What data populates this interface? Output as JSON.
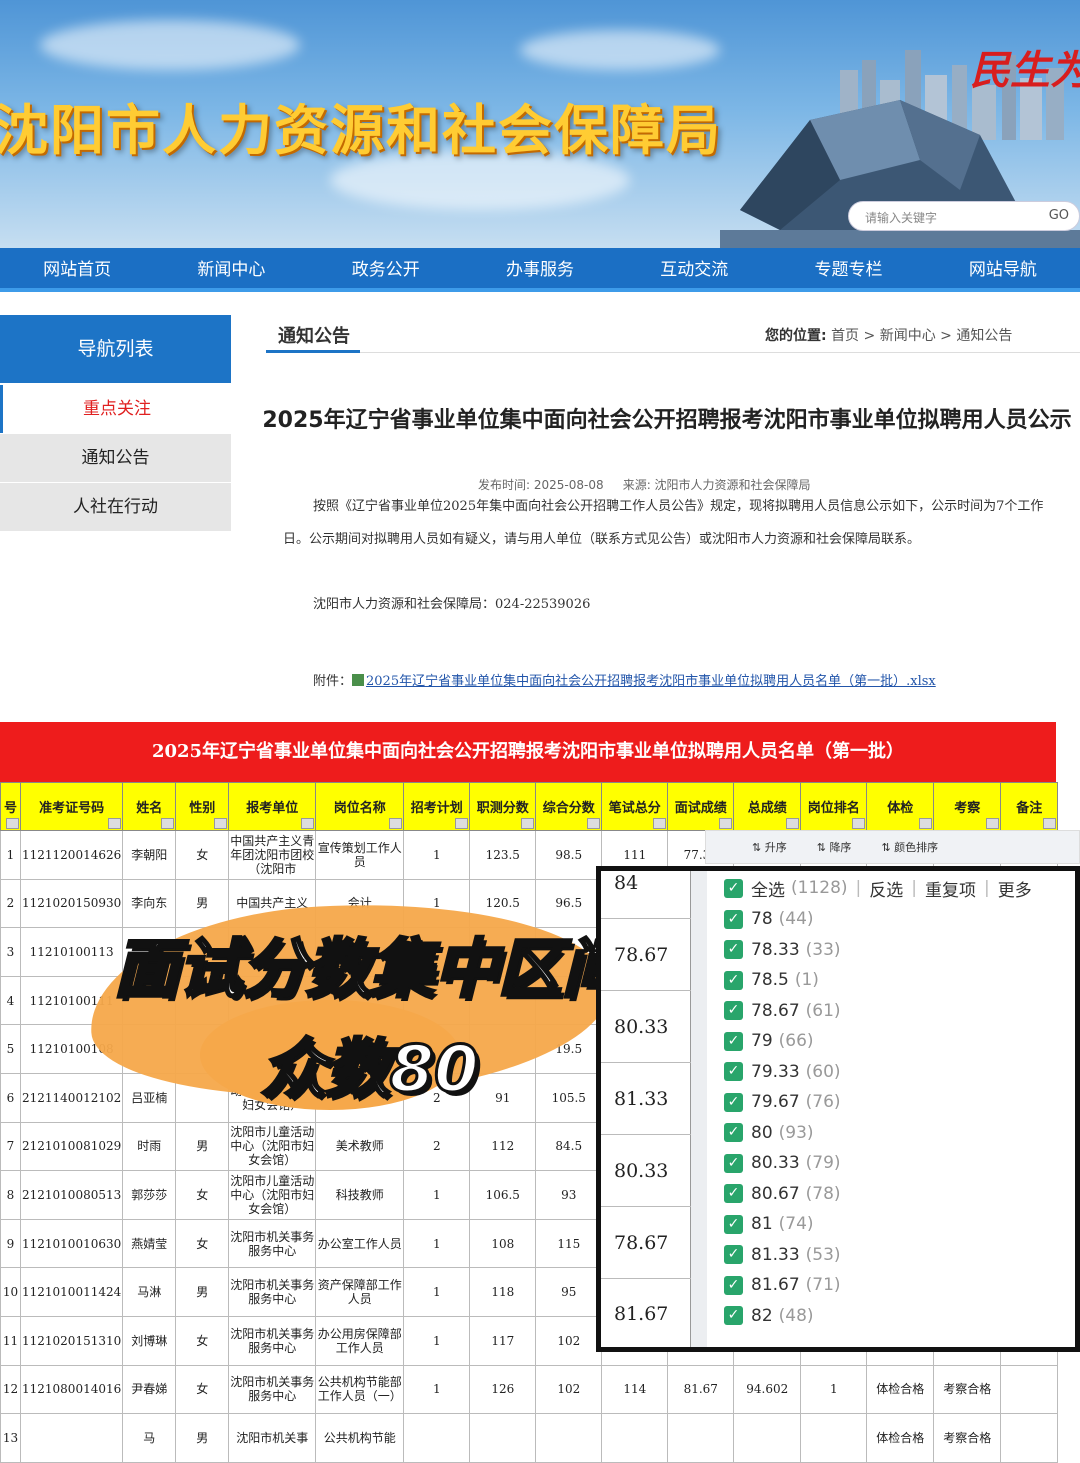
{
  "banner": {
    "site_title": "沈阳市人力资源和社会保障局",
    "slogan": "民生为",
    "search_placeholder": "请输入关键字",
    "search_go": "GO"
  },
  "nav": [
    "网站首页",
    "新闻中心",
    "政务公开",
    "办事服务",
    "互动交流",
    "专题专栏",
    "网站导航"
  ],
  "sidebar": {
    "header": "导航列表",
    "items": [
      "重点关注",
      "通知公告",
      "人社在行动"
    ]
  },
  "content": {
    "tab": "通知公告",
    "breadcrumb_label": "您的位置:",
    "breadcrumb": "首页 > 新闻中心 > 通知公告",
    "title": "2025年辽宁省事业单位集中面向社会公开招聘报考沈阳市事业单位拟聘用人员公示",
    "publish_time": "发布时间: 2025-08-08",
    "source": "来源: 沈阳市人力资源和社会保障局",
    "paragraph1": "按照《辽宁省事业单位2025年集中面向社会公开招聘工作人员公告》规定，现将拟聘用人员信息公示如下，公示时间为7个工作日。公示期间对拟聘用人员如有疑义，请与用人单位（联系方式见公告）或沈阳市人力资源和社会保障局联系。",
    "paragraph2": "沈阳市人力资源和社会保障局：024-22539026",
    "attach_label": "附件：",
    "attach_link": "2025年辽宁省事业单位集中面向社会公开招聘报考沈阳市事业单位拟聘用人员名单（第一批）.xlsx"
  },
  "sheet": {
    "title": "2025年辽宁省事业单位集中面向社会公开招聘报考沈阳市事业单位拟聘用人员名单（第一批）",
    "headers": [
      "号",
      "准考证号码",
      "姓名",
      "性别",
      "报考单位",
      "岗位名称",
      "招考计划",
      "职测分数",
      "综合分数",
      "笔试总分",
      "面试成绩",
      "总成绩",
      "岗位排名",
      "体检",
      "考察",
      "备注"
    ],
    "rows": [
      [
        "1",
        "1121120014626",
        "李朝阳",
        "女",
        "中国共产主义青年团沈阳市团校（沈阳市",
        "宣传策划工作人员",
        "1",
        "123.5",
        "98.5",
        "111",
        "77.33",
        "",
        "",
        "",
        "",
        ""
      ],
      [
        "2",
        "1121020150930",
        "李向东",
        "男",
        "中国共产主义",
        "会计",
        "1",
        "120.5",
        "96.5",
        "",
        "",
        "",
        "",
        "",
        "",
        ""
      ],
      [
        "3",
        "11210100113",
        "",
        "",
        "",
        "",
        "",
        "",
        "",
        "",
        "",
        "",
        "",
        "",
        "",
        ""
      ],
      [
        "4",
        "11210100111",
        "",
        "",
        "",
        "",
        "",
        "",
        "",
        "",
        "",
        "",
        "",
        "",
        "",
        ""
      ],
      [
        "5",
        "11210100108",
        "",
        "",
        "",
        "",
        "",
        "",
        "19.5",
        "",
        "",
        "",
        "",
        "",
        "",
        ""
      ],
      [
        "6",
        "2121140012102",
        "吕亚楠",
        "",
        "动中心（沈阳市妇女会馆）",
        "美术教师",
        "2",
        "91",
        "105.5",
        "",
        "",
        "",
        "",
        "",
        "",
        ""
      ],
      [
        "7",
        "2121010081029",
        "时雨",
        "男",
        "沈阳市儿童活动中心（沈阳市妇女会馆）",
        "美术教师",
        "2",
        "112",
        "84.5",
        "",
        "",
        "",
        "",
        "",
        "",
        ""
      ],
      [
        "8",
        "2121010080513",
        "郭莎莎",
        "女",
        "沈阳市儿童活动中心（沈阳市妇女会馆）",
        "科技教师",
        "1",
        "106.5",
        "93",
        "",
        "",
        "",
        "",
        "",
        "",
        ""
      ],
      [
        "9",
        "1121010010630",
        "燕婧莹",
        "女",
        "沈阳市机关事务服务中心",
        "办公室工作人员",
        "1",
        "108",
        "115",
        "",
        "",
        "",
        "",
        "",
        "",
        ""
      ],
      [
        "10",
        "1121010011424",
        "马淋",
        "男",
        "沈阳市机关事务服务中心",
        "资产保障部工作人员",
        "1",
        "118",
        "95",
        "",
        "",
        "",
        "",
        "",
        "",
        ""
      ],
      [
        "11",
        "1121020151310",
        "刘博琳",
        "女",
        "沈阳市机关事务服务中心",
        "办公用房保障部工作人员",
        "1",
        "117",
        "102",
        "",
        "",
        "",
        "",
        "",
        "",
        ""
      ],
      [
        "12",
        "1121080014016",
        "尹春娣",
        "女",
        "沈阳市机关事务服务中心",
        "公共机构节能部工作人员（一）",
        "1",
        "126",
        "102",
        "114",
        "81.67",
        "94.602",
        "1",
        "体检合格",
        "考察合格",
        ""
      ],
      [
        "13",
        "",
        "马",
        "男",
        "沈阳市机关事",
        "公共机构节能",
        "",
        "",
        "",
        "",
        "",
        "",
        "",
        "体检合格",
        "考察合格",
        ""
      ]
    ]
  },
  "overlay": {
    "line1": "面试分数集中区间",
    "line2": "众数80"
  },
  "sort_toolbar": [
    "升序",
    "降序",
    "颜色排序"
  ],
  "zoom": {
    "cells": [
      "84",
      "78.67",
      "80.33",
      "81.33",
      "80.33",
      "78.67",
      "81.67"
    ],
    "filter_head": {
      "select_all": "全选",
      "total": "(1128)",
      "invert": "反选",
      "dup": "重复项",
      "more": "更多"
    },
    "filter_items": [
      {
        "value": "78",
        "count": "(44)"
      },
      {
        "value": "78.33",
        "count": "(33)"
      },
      {
        "value": "78.5",
        "count": "(1)"
      },
      {
        "value": "78.67",
        "count": "(61)"
      },
      {
        "value": "79",
        "count": "(66)"
      },
      {
        "value": "79.33",
        "count": "(60)"
      },
      {
        "value": "79.67",
        "count": "(76)"
      },
      {
        "value": "80",
        "count": "(93)"
      },
      {
        "value": "80.33",
        "count": "(79)"
      },
      {
        "value": "80.67",
        "count": "(78)"
      },
      {
        "value": "81",
        "count": "(74)"
      },
      {
        "value": "81.33",
        "count": "(53)"
      },
      {
        "value": "81.67",
        "count": "(71)"
      },
      {
        "value": "82",
        "count": "(48)"
      }
    ]
  }
}
